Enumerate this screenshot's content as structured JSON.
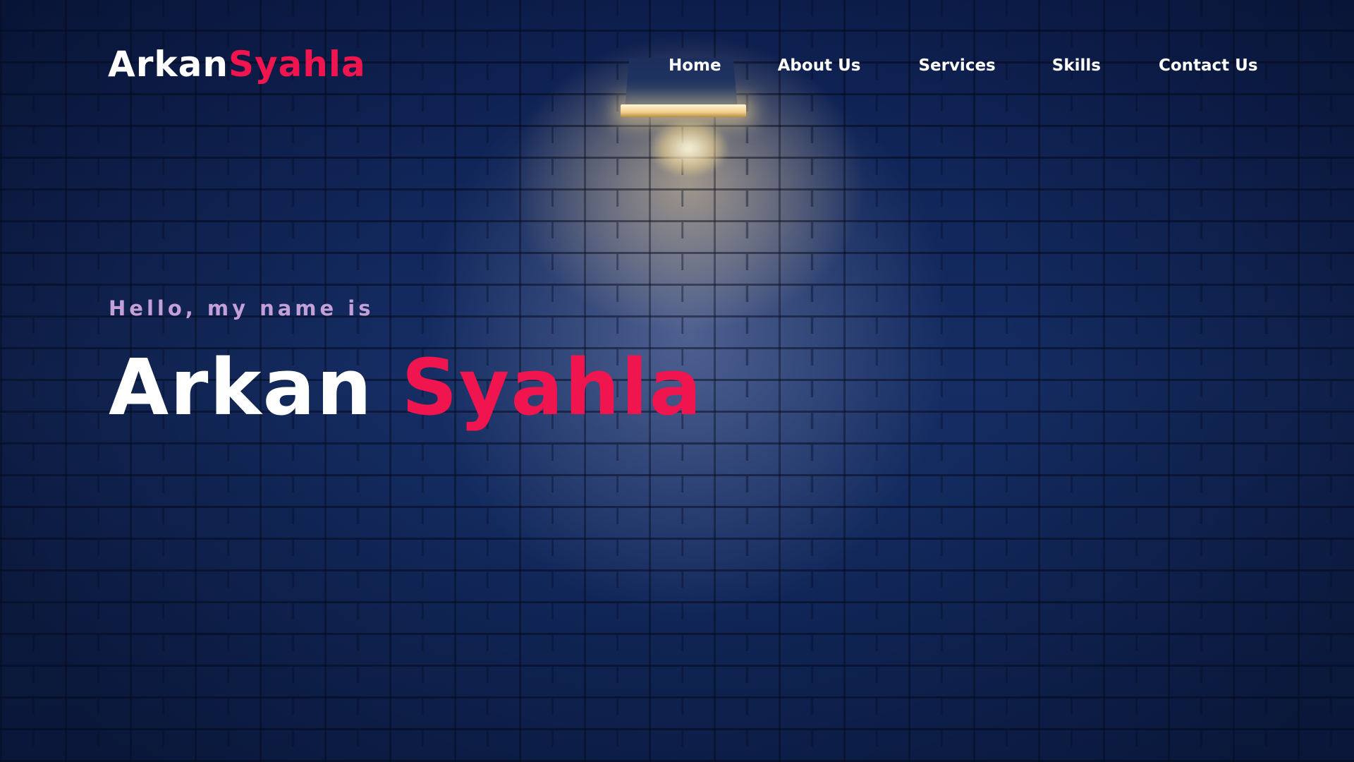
{
  "brand": {
    "first": "Arkan",
    "last": "Syahla"
  },
  "nav": {
    "items": [
      {
        "label": "Home"
      },
      {
        "label": "About Us"
      },
      {
        "label": "Services"
      },
      {
        "label": "Skills"
      },
      {
        "label": "Contact Us"
      }
    ]
  },
  "hero": {
    "greeting": "Hello, my name is",
    "name_first": "Arkan",
    "name_last": "Syahla",
    "background_image": "brick-wall-with-lamp"
  },
  "colors": {
    "accent": "#f0144f",
    "greeting": "#c3a0d8",
    "text": "#ffffff",
    "background": "#13285a"
  }
}
